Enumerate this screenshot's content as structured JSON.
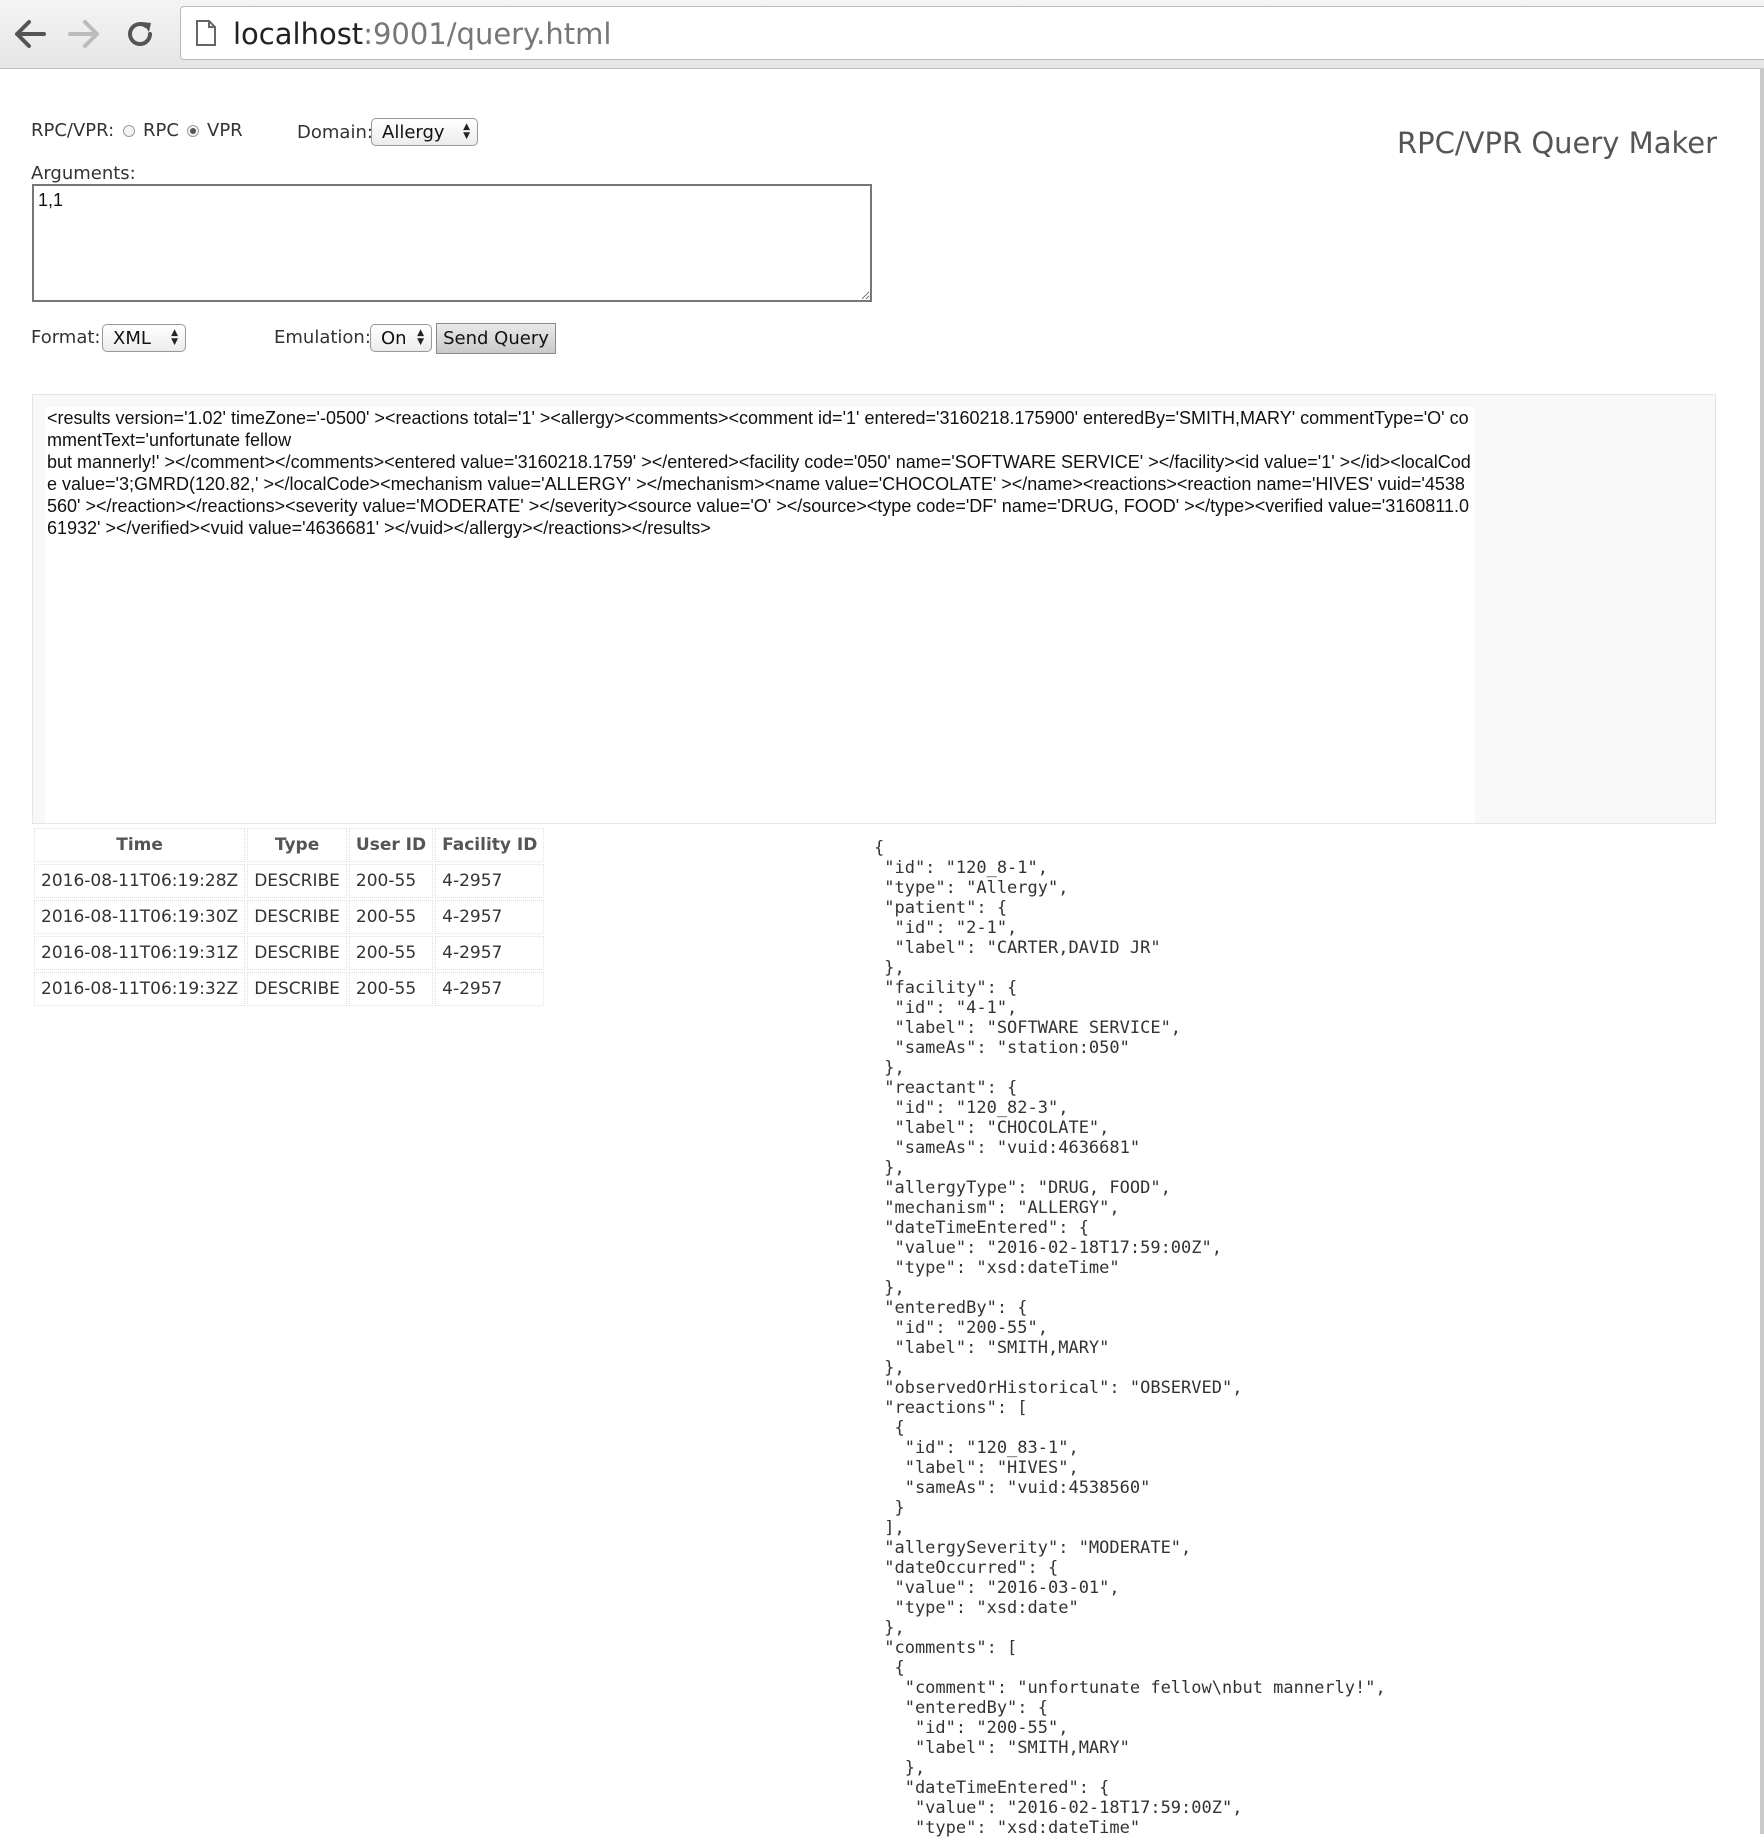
{
  "browser": {
    "url_host": "localhost",
    "url_rest": ":9001/query.html"
  },
  "form": {
    "rpcvpr_label": "RPC/VPR:",
    "option_rpc": "RPC",
    "option_vpr": "VPR",
    "selected_mode": "VPR",
    "domain_label": "Domain:",
    "domain_value": "Allergy",
    "arguments_label": "Arguments:",
    "arguments_value": "1,1",
    "format_label": "Format:",
    "format_value": "XML",
    "emulation_label": "Emulation:",
    "emulation_value": "On",
    "send_label": "Send Query"
  },
  "app_title": "RPC/VPR Query Maker",
  "result_xml": "<results version='1.02' timeZone='-0500' ><reactions total='1' ><allergy><comments><comment id='1' entered='3160218.175900' enteredBy='SMITH,MARY' commentType='O' commentText='unfortunate fellow\nbut mannerly!' ></comment></comments><entered value='3160218.1759' ></entered><facility code='050' name='SOFTWARE SERVICE' ></facility><id value='1' ></id><localCode value='3;GMRD(120.82,' ></localCode><mechanism value='ALLERGY' ></mechanism><name value='CHOCOLATE' ></name><reactions><reaction name='HIVES' vuid='4538560' ></reaction></reactions><severity value='MODERATE' ></severity><source value='O' ></source><type code='DF' name='DRUG, FOOD' ></type><verified value='3160811.061932' ></verified><vuid value='4636681' ></vuid></allergy></reactions></results>",
  "log": {
    "headers": [
      "Time",
      "Type",
      "User ID",
      "Facility ID"
    ],
    "rows": [
      [
        "2016-08-11T06:19:28Z",
        "DESCRIBE",
        "200-55",
        "4-2957"
      ],
      [
        "2016-08-11T06:19:30Z",
        "DESCRIBE",
        "200-55",
        "4-2957"
      ],
      [
        "2016-08-11T06:19:31Z",
        "DESCRIBE",
        "200-55",
        "4-2957"
      ],
      [
        "2016-08-11T06:19:32Z",
        "DESCRIBE",
        "200-55",
        "4-2957"
      ]
    ]
  },
  "json_output": "{\n \"id\": \"120_8-1\",\n \"type\": \"Allergy\",\n \"patient\": {\n  \"id\": \"2-1\",\n  \"label\": \"CARTER,DAVID JR\"\n },\n \"facility\": {\n  \"id\": \"4-1\",\n  \"label\": \"SOFTWARE SERVICE\",\n  \"sameAs\": \"station:050\"\n },\n \"reactant\": {\n  \"id\": \"120_82-3\",\n  \"label\": \"CHOCOLATE\",\n  \"sameAs\": \"vuid:4636681\"\n },\n \"allergyType\": \"DRUG, FOOD\",\n \"mechanism\": \"ALLERGY\",\n \"dateTimeEntered\": {\n  \"value\": \"2016-02-18T17:59:00Z\",\n  \"type\": \"xsd:dateTime\"\n },\n \"enteredBy\": {\n  \"id\": \"200-55\",\n  \"label\": \"SMITH,MARY\"\n },\n \"observedOrHistorical\": \"OBSERVED\",\n \"reactions\": [\n  {\n   \"id\": \"120_83-1\",\n   \"label\": \"HIVES\",\n   \"sameAs\": \"vuid:4538560\"\n  }\n ],\n \"allergySeverity\": \"MODERATE\",\n \"dateOccurred\": {\n  \"value\": \"2016-03-01\",\n  \"type\": \"xsd:date\"\n },\n \"comments\": [\n  {\n   \"comment\": \"unfortunate fellow\\nbut mannerly!\",\n   \"enteredBy\": {\n    \"id\": \"200-55\",\n    \"label\": \"SMITH,MARY\"\n   },\n   \"dateTimeEntered\": {\n    \"value\": \"2016-02-18T17:59:00Z\",\n    \"type\": \"xsd:dateTime\""
}
